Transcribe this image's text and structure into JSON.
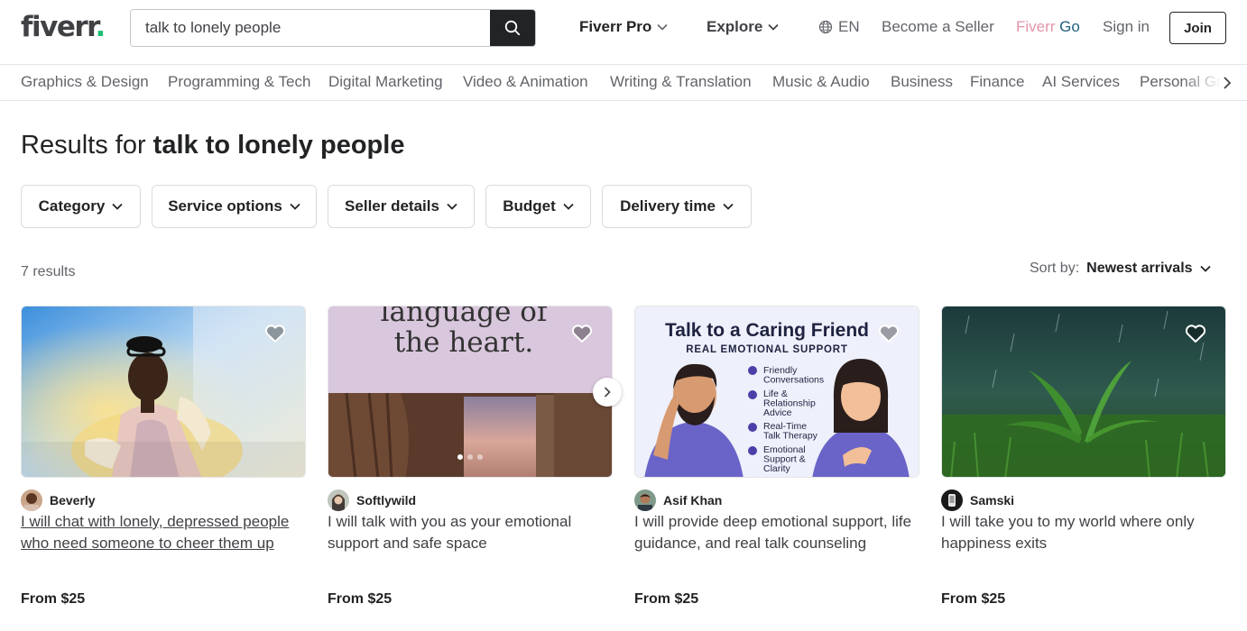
{
  "header": {
    "logo_text": "fiverr",
    "logo_dot": ".",
    "search_value": "talk to lonely people",
    "nav": {
      "fiverr_pro": "Fiverr Pro",
      "explore": "Explore",
      "language": "EN",
      "become_seller": "Become a Seller",
      "fiverr_go_a": "Fiverr",
      "fiverr_go_b": " Go",
      "sign_in": "Sign in",
      "join": "Join"
    }
  },
  "categories": [
    "Graphics & Design",
    "Programming & Tech",
    "Digital Marketing",
    "Video & Animation",
    "Writing & Translation",
    "Music & Audio",
    "Business",
    "Finance",
    "AI Services",
    "Personal Gr"
  ],
  "results": {
    "prefix": "Results for ",
    "query": "talk to lonely people",
    "count": "7 results",
    "sort_label": "Sort by:",
    "sort_value": "Newest arrivals"
  },
  "filters": [
    "Category",
    "Service options",
    "Seller details",
    "Budget",
    "Delivery time"
  ],
  "gigs": [
    {
      "seller": "Beverly",
      "title": "I will chat with lonely, depressed people who need someone to cheer them up",
      "price": "From $25"
    },
    {
      "seller": "Softlywild",
      "title": "I will talk with you as your emotional support and safe space",
      "price": "From $25",
      "image_text_1": "language of",
      "image_text_2": "the heart."
    },
    {
      "seller": "Asif Khan",
      "title": "I will provide deep emotional support, life guidance, and real talk counseling",
      "price": "From $25",
      "image_heading": "Talk to a Caring Friend",
      "image_sub": "REAL EMOTIONAL SUPPORT",
      "image_points": [
        "Friendly|Conversations",
        "Life &|Relationship|Advice",
        "Real-Time|Talk Therapy",
        "Emotional|Support &|Clarity"
      ]
    },
    {
      "seller": "Samski",
      "title": "I will take you to my world where only happiness exits",
      "price": "From $25"
    }
  ],
  "colors": {
    "brand_green": "#1dbf73",
    "text_dark": "#222325",
    "text_muted": "#62646a",
    "fiverr_go_pink": "#e394a8",
    "fiverr_go_blue": "#1e5f7f"
  }
}
